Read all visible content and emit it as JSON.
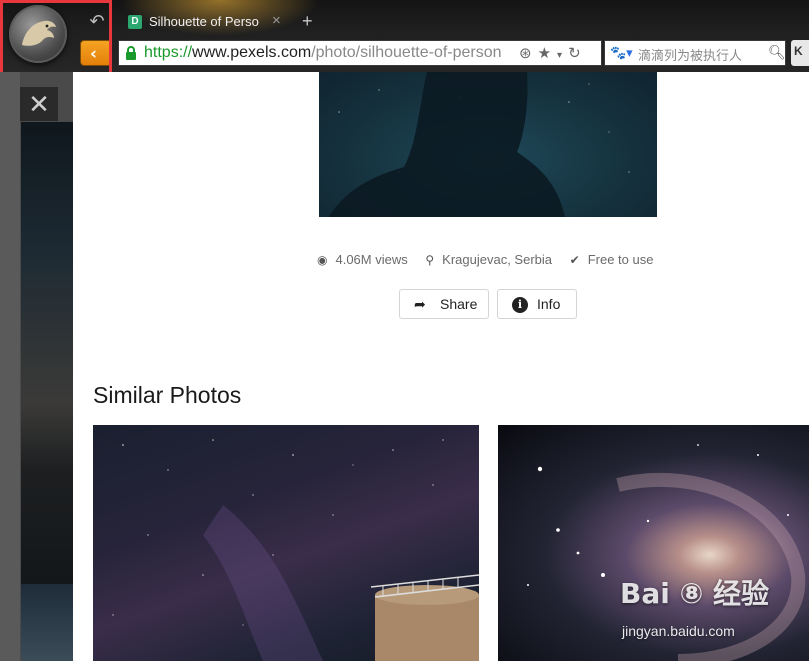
{
  "browser": {
    "tab_title": "Silhouette of Perso",
    "tab_favicon_letter": "D",
    "new_tab_symbol": "+",
    "close_symbol": "×",
    "url_protocol": "https://",
    "url_host": "www.pexels.com",
    "url_path": "/photo/silhouette-of-person",
    "search_placeholder": "滴滴列为被执行人",
    "ext_letter": "K"
  },
  "sidebar": {
    "close_symbol": "✕"
  },
  "photo": {
    "views": "4.06M views",
    "location": "Kragujevac, Serbia",
    "license": "Free to use",
    "share_label": "Share",
    "info_label": "Info"
  },
  "similar": {
    "title": "Similar Photos"
  },
  "watermark": {
    "brand": "Bai ⑧ 经验",
    "domain": "jingyan.baidu.com"
  },
  "icons": {
    "eye": "eye-icon",
    "pin": "map-pin-icon",
    "check": "check-circle-icon",
    "share": "share-arrow-icon",
    "info": "info-icon"
  },
  "colors": {
    "back_button": "#f0960f",
    "highlight": "#e8383d",
    "url_secure": "#1a9a2c"
  }
}
